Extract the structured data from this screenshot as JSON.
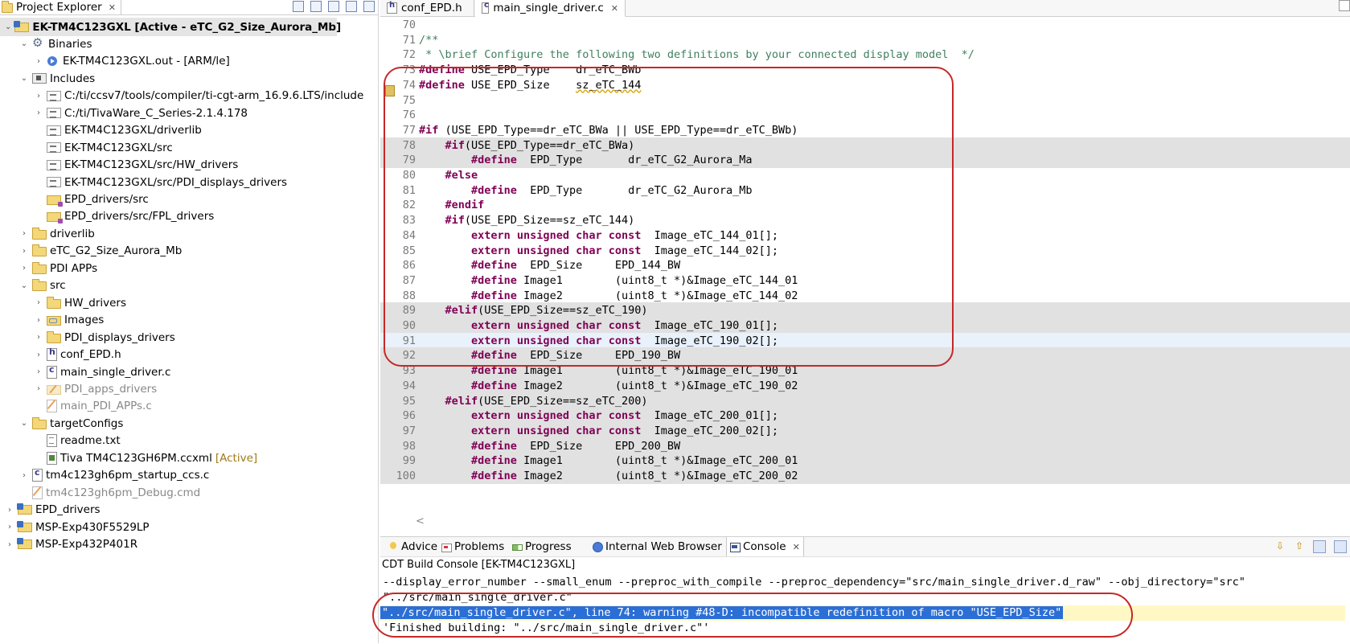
{
  "explorer": {
    "tab_label": "Project Explorer",
    "tree": [
      {
        "label": "EK-TM4C123GXL  [Active - eTC_G2_Size_Aurora_Mb]",
        "icon": "project-icon",
        "level": 0,
        "twisty": "expanded",
        "bold": true,
        "selected": true
      },
      {
        "label": "Binaries",
        "icon": "binaries-icon",
        "level": 1,
        "twisty": "expanded"
      },
      {
        "label": "EK-TM4C123GXL.out - [ARM/le]",
        "icon": "executable-icon",
        "level": 2,
        "twisty": "collapsed"
      },
      {
        "label": "Includes",
        "icon": "includes-icon",
        "level": 1,
        "twisty": "expanded"
      },
      {
        "label": "C:/ti/ccsv7/tools/compiler/ti-cgt-arm_16.9.6.LTS/include",
        "icon": "include-folder-icon",
        "level": 2,
        "twisty": "collapsed"
      },
      {
        "label": "C:/ti/TivaWare_C_Series-2.1.4.178",
        "icon": "include-folder-icon",
        "level": 2,
        "twisty": "collapsed"
      },
      {
        "label": "EK-TM4C123GXL/driverlib",
        "icon": "include-folder-icon",
        "level": 2,
        "twisty": "none"
      },
      {
        "label": "EK-TM4C123GXL/src",
        "icon": "include-folder-icon",
        "level": 2,
        "twisty": "none"
      },
      {
        "label": "EK-TM4C123GXL/src/HW_drivers",
        "icon": "include-folder-icon",
        "level": 2,
        "twisty": "none"
      },
      {
        "label": "EK-TM4C123GXL/src/PDI_displays_drivers",
        "icon": "include-folder-icon",
        "level": 2,
        "twisty": "none"
      },
      {
        "label": "EPD_drivers/src",
        "icon": "source-folder-icon",
        "level": 2,
        "twisty": "none"
      },
      {
        "label": "EPD_drivers/src/FPL_drivers",
        "icon": "source-folder-icon",
        "level": 2,
        "twisty": "none"
      },
      {
        "label": "driverlib",
        "icon": "folder-icon",
        "level": 1,
        "twisty": "collapsed"
      },
      {
        "label": "eTC_G2_Size_Aurora_Mb",
        "icon": "folder-icon",
        "level": 1,
        "twisty": "collapsed"
      },
      {
        "label": "PDI APPs",
        "icon": "folder-icon",
        "level": 1,
        "twisty": "collapsed"
      },
      {
        "label": "src",
        "icon": "folder-icon",
        "level": 1,
        "twisty": "expanded"
      },
      {
        "label": "HW_drivers",
        "icon": "folder-icon",
        "level": 2,
        "twisty": "collapsed"
      },
      {
        "label": "Images",
        "icon": "linked-folder-icon",
        "level": 2,
        "twisty": "collapsed"
      },
      {
        "label": "PDI_displays_drivers",
        "icon": "folder-icon",
        "level": 2,
        "twisty": "collapsed"
      },
      {
        "label": "conf_EPD.h",
        "icon": "header-file-icon",
        "level": 2,
        "twisty": "collapsed"
      },
      {
        "label": "main_single_driver.c",
        "icon": "c-file-icon",
        "level": 2,
        "twisty": "collapsed"
      },
      {
        "label": "PDI_apps_drivers",
        "icon": "excluded-folder-icon",
        "level": 2,
        "twisty": "collapsed",
        "dim": true
      },
      {
        "label": "main_PDI_APPs.c",
        "icon": "excluded-file-icon",
        "level": 2,
        "twisty": "none",
        "dim": true
      },
      {
        "label": "targetConfigs",
        "icon": "folder-icon",
        "level": 1,
        "twisty": "expanded"
      },
      {
        "label": "readme.txt",
        "icon": "text-file-icon",
        "level": 2,
        "twisty": "none"
      },
      {
        "label": "Tiva TM4C123GH6PM.ccxml",
        "icon": "target-config-icon",
        "level": 2,
        "twisty": "none",
        "decoration": "[Active]"
      },
      {
        "label": "tm4c123gh6pm_startup_ccs.c",
        "icon": "c-file-icon",
        "level": 1,
        "twisty": "collapsed"
      },
      {
        "label": "tm4c123gh6pm_Debug.cmd",
        "icon": "excluded-file-icon",
        "level": 1,
        "twisty": "none",
        "dim": true
      },
      {
        "label": "EPD_drivers",
        "icon": "project-icon",
        "level": 0,
        "twisty": "collapsed"
      },
      {
        "label": "MSP-Exp430F5529LP",
        "icon": "project-icon",
        "level": 0,
        "twisty": "collapsed"
      },
      {
        "label": "MSP-Exp432P401R",
        "icon": "project-icon",
        "level": 0,
        "twisty": "collapsed"
      }
    ]
  },
  "editor": {
    "tabs": [
      {
        "label": "conf_EPD.h",
        "icon": "header-file-icon",
        "active": false
      },
      {
        "label": "main_single_driver.c",
        "icon": "c-file-icon",
        "active": true
      }
    ],
    "scroll_hint": "<",
    "lines": [
      {
        "n": "70",
        "bg": "none",
        "t": [
          [
            "",
            ""
          ]
        ]
      },
      {
        "n": "71",
        "bg": "none",
        "t": [
          [
            "cm",
            "/**"
          ]
        ]
      },
      {
        "n": "72",
        "bg": "none",
        "t": [
          [
            "cm",
            " * \\brief Configure the following two definitions by your connected display model  */"
          ]
        ]
      },
      {
        "n": "73",
        "bg": "none",
        "t": [
          [
            "kw",
            "#define"
          ],
          [
            "",
            " USE_EPD_Type    dr_eTC_BWb"
          ]
        ]
      },
      {
        "n": "74",
        "bg": "none",
        "t": [
          [
            "kw",
            "#define"
          ],
          [
            "",
            " USE_EPD_Size    "
          ],
          [
            "warn",
            "sz_eTC_144"
          ]
        ]
      },
      {
        "n": "75",
        "bg": "none",
        "t": [
          [
            "",
            ""
          ]
        ]
      },
      {
        "n": "76",
        "bg": "none",
        "t": [
          [
            "",
            ""
          ]
        ]
      },
      {
        "n": "77",
        "bg": "none",
        "t": [
          [
            "kw",
            "#if"
          ],
          [
            "",
            " (USE_EPD_Type==dr_eTC_BWa || USE_EPD_Type==dr_eTC_BWb)"
          ]
        ]
      },
      {
        "n": "78",
        "bg": "gray",
        "t": [
          [
            "",
            "    "
          ],
          [
            "kw",
            "#if"
          ],
          [
            "",
            "(USE_EPD_Type==dr_eTC_BWa)"
          ]
        ]
      },
      {
        "n": "79",
        "bg": "gray",
        "t": [
          [
            "",
            "        "
          ],
          [
            "kw",
            "#define"
          ],
          [
            "",
            "  EPD_Type       dr_eTC_G2_Aurora_Ma"
          ]
        ]
      },
      {
        "n": "80",
        "bg": "none",
        "t": [
          [
            "",
            "    "
          ],
          [
            "kw",
            "#else"
          ]
        ]
      },
      {
        "n": "81",
        "bg": "none",
        "t": [
          [
            "",
            "        "
          ],
          [
            "kw",
            "#define"
          ],
          [
            "",
            "  EPD_Type       dr_eTC_G2_Aurora_Mb"
          ]
        ]
      },
      {
        "n": "82",
        "bg": "none",
        "t": [
          [
            "",
            "    "
          ],
          [
            "kw",
            "#endif"
          ]
        ]
      },
      {
        "n": "83",
        "bg": "none",
        "t": [
          [
            "",
            "    "
          ],
          [
            "kw",
            "#if"
          ],
          [
            "",
            "(USE_EPD_Size==sz_eTC_144)"
          ]
        ]
      },
      {
        "n": "84",
        "bg": "none",
        "t": [
          [
            "",
            "        "
          ],
          [
            "kw",
            "extern unsigned char const"
          ],
          [
            "",
            "  Image_eTC_144_01[];"
          ]
        ]
      },
      {
        "n": "85",
        "bg": "none",
        "t": [
          [
            "",
            "        "
          ],
          [
            "kw",
            "extern unsigned char const"
          ],
          [
            "",
            "  Image_eTC_144_02[];"
          ]
        ]
      },
      {
        "n": "86",
        "bg": "none",
        "t": [
          [
            "",
            "        "
          ],
          [
            "kw",
            "#define"
          ],
          [
            "",
            "  EPD_Size     EPD_144_BW"
          ]
        ]
      },
      {
        "n": "87",
        "bg": "none",
        "t": [
          [
            "",
            "        "
          ],
          [
            "kw",
            "#define"
          ],
          [
            "",
            " Image1        (uint8_t *)&Image_eTC_144_01"
          ]
        ]
      },
      {
        "n": "88",
        "bg": "none",
        "t": [
          [
            "",
            "        "
          ],
          [
            "kw",
            "#define"
          ],
          [
            "",
            " Image2        (uint8_t *)&Image_eTC_144_02"
          ]
        ]
      },
      {
        "n": "89",
        "bg": "gray",
        "t": [
          [
            "",
            "    "
          ],
          [
            "kw",
            "#elif"
          ],
          [
            "",
            "(USE_EPD_Size==sz_eTC_190)"
          ]
        ]
      },
      {
        "n": "90",
        "bg": "gray",
        "t": [
          [
            "",
            "        "
          ],
          [
            "kw",
            "extern unsigned char const"
          ],
          [
            "",
            "  Image_eTC_190_01[];"
          ]
        ]
      },
      {
        "n": "91",
        "bg": "blue",
        "t": [
          [
            "",
            "        "
          ],
          [
            "kw",
            "extern unsigned char const"
          ],
          [
            "",
            "  Image_eTC_190_02[];"
          ]
        ]
      },
      {
        "n": "92",
        "bg": "gray",
        "t": [
          [
            "",
            "        "
          ],
          [
            "kw",
            "#define"
          ],
          [
            "",
            "  EPD_Size     EPD_190_BW"
          ]
        ]
      },
      {
        "n": "93",
        "bg": "gray",
        "t": [
          [
            "",
            "        "
          ],
          [
            "kw",
            "#define"
          ],
          [
            "",
            " Image1        (uint8_t *)&Image_eTC_190_01"
          ]
        ]
      },
      {
        "n": "94",
        "bg": "gray",
        "t": [
          [
            "",
            "        "
          ],
          [
            "kw",
            "#define"
          ],
          [
            "",
            " Image2        (uint8_t *)&Image_eTC_190_02"
          ]
        ]
      },
      {
        "n": "95",
        "bg": "gray",
        "t": [
          [
            "",
            "    "
          ],
          [
            "kw",
            "#elif"
          ],
          [
            "",
            "(USE_EPD_Size==sz_eTC_200)"
          ]
        ]
      },
      {
        "n": "96",
        "bg": "gray",
        "t": [
          [
            "",
            "        "
          ],
          [
            "kw",
            "extern unsigned char const"
          ],
          [
            "",
            "  Image_eTC_200_01[];"
          ]
        ]
      },
      {
        "n": "97",
        "bg": "gray",
        "t": [
          [
            "",
            "        "
          ],
          [
            "kw",
            "extern unsigned char const"
          ],
          [
            "",
            "  Image_eTC_200_02[];"
          ]
        ]
      },
      {
        "n": "98",
        "bg": "gray",
        "t": [
          [
            "",
            "        "
          ],
          [
            "kw",
            "#define"
          ],
          [
            "",
            "  EPD_Size     EPD_200_BW"
          ]
        ]
      },
      {
        "n": "99",
        "bg": "gray",
        "t": [
          [
            "",
            "        "
          ],
          [
            "kw",
            "#define"
          ],
          [
            "",
            " Image1        (uint8_t *)&Image_eTC_200_01"
          ]
        ]
      },
      {
        "n": "100",
        "bg": "gray",
        "t": [
          [
            "",
            "        "
          ],
          [
            "kw",
            "#define"
          ],
          [
            "",
            " Image2        (uint8_t *)&Image_eTC_200_02"
          ]
        ]
      }
    ]
  },
  "bottom": {
    "tabs": [
      {
        "label": "Advice",
        "icon": "lightbulb-icon",
        "active": false
      },
      {
        "label": "Problems",
        "icon": "problems-icon",
        "active": false
      },
      {
        "label": "Progress",
        "icon": "progress-icon",
        "active": false
      },
      {
        "label": "Internal Web Browser",
        "icon": "globe-icon",
        "active": false
      },
      {
        "label": "Console",
        "icon": "console-icon",
        "active": true
      }
    ],
    "console_title": "CDT Build Console [EK-TM4C123GXL]",
    "console_lines": [
      {
        "text": "--display_error_number --small_enum --preproc_with_compile --preproc_dependency=\"src/main_single_driver.d_raw\" --obj_directory=\"src\"",
        "selected": false
      },
      {
        "text": "\"../src/main_single_driver.c\"",
        "selected": false
      },
      {
        "text": "\"../src/main_single_driver.c\", line 74: warning #48-D: incompatible redefinition of macro \"USE_EPD_Size\"",
        "selected": true
      },
      {
        "text": "'Finished building: \"../src/main_single_driver.c\"'",
        "selected": false
      }
    ]
  },
  "colors": {
    "annotation": "#c62828",
    "keyword": "#7f0055",
    "comment": "#3f7f5f",
    "selection": "#2b6fd6"
  }
}
